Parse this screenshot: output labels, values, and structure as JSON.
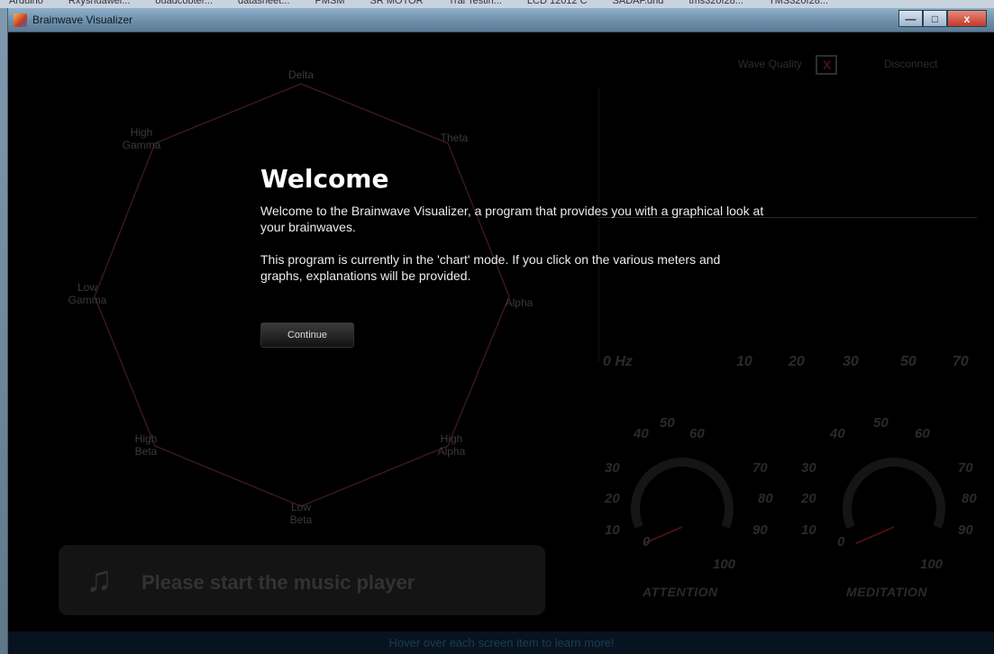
{
  "taskbar": {
    "items": [
      "Arduino",
      "Rxyshuawei...",
      "ouadcobter...",
      "datasheet...",
      "PMSM",
      "SR MOTOR",
      "Trai Testin...",
      "LCD 12012 C",
      "SADAF.dnd",
      "tms320f28...",
      "TMS320f28..."
    ]
  },
  "window": {
    "title": "Brainwave Visualizer",
    "controls": {
      "minimize": "—",
      "maximize": "□",
      "close": "x"
    }
  },
  "radar": {
    "labels": [
      "Delta",
      "Theta",
      "Alpha",
      "High Alpha",
      "Low Beta",
      "High Beta",
      "Low Gamma",
      "High Gamma"
    ]
  },
  "status": {
    "wave_quality_label": "Wave Quality",
    "wave_quality_mark": "X",
    "disconnect_label": "Disconnect"
  },
  "spectrum": {
    "hz_labels": [
      "0 Hz",
      "10",
      "20",
      "30",
      "50",
      "70"
    ]
  },
  "gauges": [
    {
      "title": "ATTENTION",
      "ticks": [
        "0",
        "10",
        "20",
        "30",
        "40",
        "50",
        "60",
        "70",
        "80",
        "90",
        "100"
      ],
      "value": 0.08
    },
    {
      "title": "MEDITATION",
      "ticks": [
        "0",
        "10",
        "20",
        "30",
        "40",
        "50",
        "60",
        "70",
        "80",
        "90",
        "100"
      ],
      "value": 0.08
    }
  ],
  "music": {
    "icon": "music-note-icon",
    "text": "Please start the music player"
  },
  "hover_hint": "Hover over each screen item to learn more!",
  "welcome": {
    "title": "Welcome",
    "paragraph1": "Welcome to the Brainwave Visualizer, a program that provides you with a graphical look at your brainwaves.",
    "paragraph2": "This program is currently in the 'chart' mode. If you click on the various meters and graphs, explanations will be provided.",
    "continue_label": "Continue"
  }
}
